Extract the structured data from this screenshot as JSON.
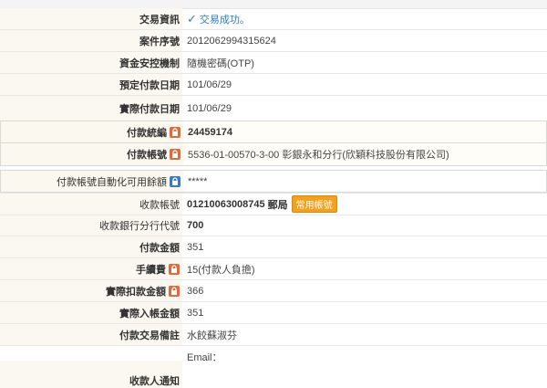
{
  "rows": [
    {
      "label": "交易資訊",
      "value": "交易成功。"
    },
    {
      "label": "案件序號",
      "value": "2012062994315624"
    },
    {
      "label": "資金安控機制",
      "value": "隨機密碼(OTP)"
    },
    {
      "label": "預定付款日期",
      "value": "101/06/29"
    },
    {
      "label": "實際付款日期",
      "value": "101/06/29"
    },
    {
      "label": "付款統編",
      "value": "24459174"
    },
    {
      "label": "付款帳號",
      "value": "5536-01-00570-3-00 彰銀永和分行(欣穎科技股份有限公司)"
    },
    {
      "label": "付款帳號自動化可用餘額",
      "value": "*****"
    },
    {
      "label": "收款帳號",
      "value": "01210063008745",
      "extra": "郵局",
      "badge": "常用帳號"
    },
    {
      "label": "收款銀行分行代號",
      "value": "700"
    },
    {
      "label": "付款金額",
      "value": "351"
    },
    {
      "label": "手續費",
      "value": "15(付款人負擔)"
    },
    {
      "label": "實際扣款金額",
      "value": "366"
    },
    {
      "label": "實際入帳金額",
      "value": "351"
    },
    {
      "label": "付款交易備註",
      "value": "水餃蘇淑芬"
    },
    {
      "label": "收款人通知",
      "value": "Email："
    }
  ],
  "colors": {
    "accent": "#2c7ec8",
    "lock_red": "#e06a3a",
    "lock_blue": "#3a78c8",
    "badge": "#f2a11c"
  },
  "icons": {
    "check": "check-icon",
    "lock": "lock-icon"
  }
}
